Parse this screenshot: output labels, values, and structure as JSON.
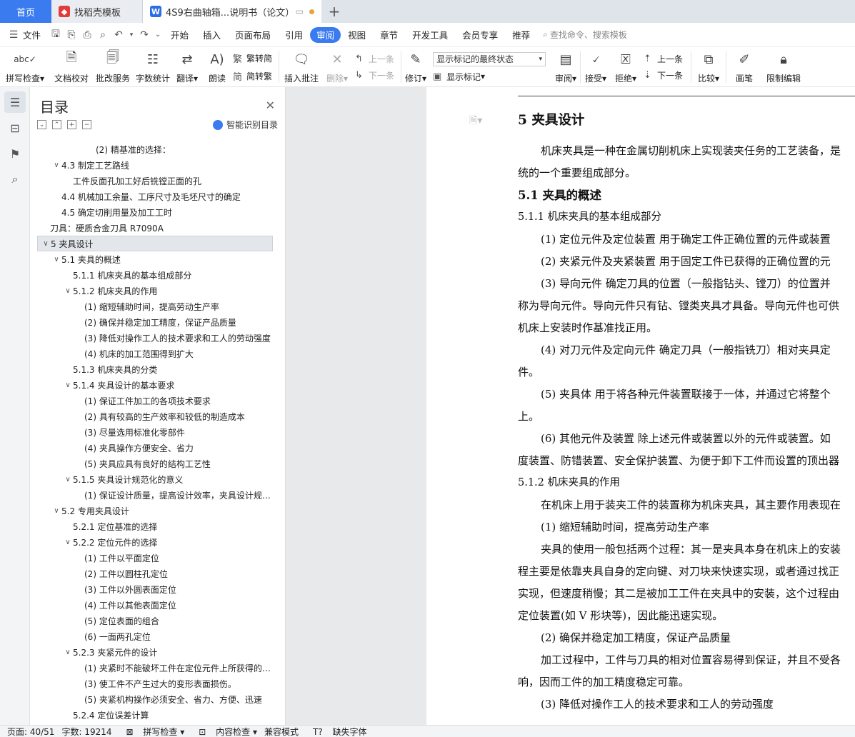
{
  "tabs": [
    {
      "label": "首页"
    },
    {
      "label": "找稻壳模板"
    },
    {
      "label": "4S9右曲轴箱...说明书（论文）"
    }
  ],
  "menu": {
    "file": "文件",
    "items": [
      "开始",
      "插入",
      "页面布局",
      "引用",
      "审阅",
      "视图",
      "章节",
      "开发工具",
      "会员专享",
      "推荐"
    ],
    "active": "审阅",
    "search_placeholder": "查找命令、搜索模板"
  },
  "ribbon": {
    "spell": "拼写检查",
    "doc_check": "文档校对",
    "batch": "批改服务",
    "word_count": "字数统计",
    "translate": "翻译",
    "read": "朗读",
    "to_trad": "繁转简",
    "to_simp": "简转繁",
    "insert_comment": "插入批注",
    "delete": "删除",
    "prev1": "上一条",
    "next1": "下一条",
    "revise": "修订",
    "markup_select": "显示标记的最终状态",
    "show_markup": "显示标记",
    "review": "审阅",
    "accept": "接受",
    "reject": "拒绝",
    "prev2": "上一条",
    "next2": "下一条",
    "compare": "比较",
    "pen": "画笔",
    "restrict": "限制编辑"
  },
  "toc": {
    "title": "目录",
    "smart": "智能识别目录",
    "items": [
      {
        "text": "(2)  精基准的选择：",
        "indent": 4,
        "arrow": ""
      },
      {
        "text": "4.3    制定工艺路线",
        "indent": 1,
        "arrow": "v"
      },
      {
        "text": "工件反面孔加工好后铣镗正面的孔",
        "indent": 2,
        "arrow": ""
      },
      {
        "text": "4.4    机械加工余量、工序尺寸及毛坯尺寸的确定",
        "indent": 1,
        "arrow": ""
      },
      {
        "text": "4.5    确定切削用量及加工工时",
        "indent": 1,
        "arrow": ""
      },
      {
        "text": "刀具：硬质合金刀具  R7090A",
        "indent": 0,
        "arrow": ""
      },
      {
        "text": "5    夹具设计",
        "indent": 0,
        "arrow": "v",
        "selected": true
      },
      {
        "text": "5.1    夹具的概述",
        "indent": 1,
        "arrow": "v"
      },
      {
        "text": "5.1.1    机床夹具的基本组成部分",
        "indent": 2,
        "arrow": ""
      },
      {
        "text": "5.1.2    机床夹具的作用",
        "indent": 2,
        "arrow": "v"
      },
      {
        "text": "(1)  缩短辅助时间，提高劳动生产率",
        "indent": 3,
        "arrow": ""
      },
      {
        "text": "(2)  确保并稳定加工精度，保证产品质量",
        "indent": 3,
        "arrow": ""
      },
      {
        "text": "(3)  降低对操作工人的技术要求和工人的劳动强度",
        "indent": 3,
        "arrow": ""
      },
      {
        "text": "(4)  机床的加工范围得到扩大",
        "indent": 3,
        "arrow": ""
      },
      {
        "text": "5.1.3    机床夹具的分类",
        "indent": 2,
        "arrow": ""
      },
      {
        "text": "5.1.4    夹具设计的基本要求",
        "indent": 2,
        "arrow": "v"
      },
      {
        "text": "(1)  保证工件加工的各项技术要求",
        "indent": 3,
        "arrow": ""
      },
      {
        "text": "(2)  具有较高的生产效率和较低的制造成本",
        "indent": 3,
        "arrow": ""
      },
      {
        "text": "(3)  尽量选用标准化零部件",
        "indent": 3,
        "arrow": ""
      },
      {
        "text": "(4)  夹具操作方便安全、省力",
        "indent": 3,
        "arrow": ""
      },
      {
        "text": "(5)  夹具应具有良好的结构工艺性",
        "indent": 3,
        "arrow": ""
      },
      {
        "text": "5.1.5    夹具设计规范化的意义",
        "indent": 2,
        "arrow": "v"
      },
      {
        "text": "(1)  保证设计质量，提高设计效率，夹具设计规范化",
        "indent": 3,
        "arrow": ""
      },
      {
        "text": "5.2    专用夹具设计",
        "indent": 1,
        "arrow": "v"
      },
      {
        "text": "5.2.1  定位基准的选择",
        "indent": 2,
        "arrow": ""
      },
      {
        "text": "5.2.2    定位元件的选择",
        "indent": 2,
        "arrow": "v"
      },
      {
        "text": "(1)  工件以平面定位",
        "indent": 3,
        "arrow": ""
      },
      {
        "text": "(2)  工件以圆柱孔定位",
        "indent": 3,
        "arrow": ""
      },
      {
        "text": "(3)  工件以外圆表面定位",
        "indent": 3,
        "arrow": ""
      },
      {
        "text": "(4)  工件以其他表面定位",
        "indent": 3,
        "arrow": ""
      },
      {
        "text": "(5)  定位表面的组合",
        "indent": 3,
        "arrow": ""
      },
      {
        "text": "(6)  一面两孔定位",
        "indent": 3,
        "arrow": ""
      },
      {
        "text": "5.2.3    夹紧元件的设计",
        "indent": 2,
        "arrow": "v"
      },
      {
        "text": "(1)  夹紧时不能破坏工件在定位元件上所获得的正确位置",
        "indent": 3,
        "arrow": ""
      },
      {
        "text": "(3)  使工件不产生过大的变形表面损伤。",
        "indent": 3,
        "arrow": ""
      },
      {
        "text": "(5)  夹紧机构操作必须安全、省力、方便、迅速",
        "indent": 3,
        "arrow": ""
      },
      {
        "text": "5.2.4    定位误差计算",
        "indent": 2,
        "arrow": ""
      }
    ]
  },
  "document": {
    "paragraphs": [
      {
        "cls": "h1",
        "text": "5    夹具设计"
      },
      {
        "cls": "ind",
        "text": "机床夹具是一种在金属切削机床上实现装夹任务的工艺装备，是"
      },
      {
        "cls": "",
        "text": "统的一个重要组成部分。"
      },
      {
        "cls": "h2",
        "text": "5.1    夹具的概述"
      },
      {
        "cls": "h3",
        "text": "5.1.1    机床夹具的基本组成部分"
      },
      {
        "cls": "ind",
        "text": "(1)  定位元件及定位装置    用于确定工件正确位置的元件或装置"
      },
      {
        "cls": "ind",
        "text": "(2)  夹紧元件及夹紧装置    用于固定工件已获得的正确位置的元"
      },
      {
        "cls": "ind",
        "text": "(3)  导向元件    确定刀具的位置（一般指钻头、镗刀）的位置并"
      },
      {
        "cls": "",
        "text": "称为导向元件。导向元件只有钻、镗类夹具才具备。导向元件也可供"
      },
      {
        "cls": "",
        "text": "机床上安装时作基准找正用。"
      },
      {
        "cls": "ind",
        "text": "(4)  对刀元件及定向元件      确定刀具（一般指铣刀）相对夹具定"
      },
      {
        "cls": "",
        "text": "件。"
      },
      {
        "cls": "ind",
        "text": "(5)  夹具体    用于将各种元件装置联接于一体，并通过它将整个"
      },
      {
        "cls": "",
        "text": "上。"
      },
      {
        "cls": "ind",
        "text": "(6)  其他元件及装置    除上述元件或装置以外的元件或装置。如"
      },
      {
        "cls": "",
        "text": "度装置、防错装置、安全保护装置、为便于卸下工件而设置的顶出器"
      },
      {
        "cls": "h3",
        "text": "5.1.2    机床夹具的作用"
      },
      {
        "cls": "ind",
        "text": "在机床上用于装夹工件的装置称为机床夹具，其主要作用表现在"
      },
      {
        "cls": "ind",
        "text": "(1)  缩短辅助时间，提高劳动生产率"
      },
      {
        "cls": "ind",
        "text": "夹具的使用一般包括两个过程：其一是夹具本身在机床上的安装"
      },
      {
        "cls": "",
        "text": "程主要是依靠夹具自身的定向键、对刀块来快速实现，或者通过找正"
      },
      {
        "cls": "",
        "text": "实现，但速度稍慢；其二是被加工工件在夹具中的安装，这个过程由"
      },
      {
        "cls": "",
        "text": "定位装置(如 V 形块等)，因此能迅速实现。"
      },
      {
        "cls": "ind",
        "text": "(2)  确保并稳定加工精度，保证产品质量"
      },
      {
        "cls": "ind",
        "text": "加工过程中，工件与刀具的相对位置容易得到保证，并且不受各"
      },
      {
        "cls": "",
        "text": "响，因而工件的加工精度稳定可靠。"
      },
      {
        "cls": "ind",
        "text": "(3)  降低对操作工人的技术要求和工人的劳动强度"
      }
    ]
  },
  "status": {
    "page": "页面: 40/51",
    "words": "字数: 19214",
    "spell": "拼写检查",
    "content_check": "内容检查",
    "compat": "兼容模式",
    "missing_font": "缺失字体"
  }
}
